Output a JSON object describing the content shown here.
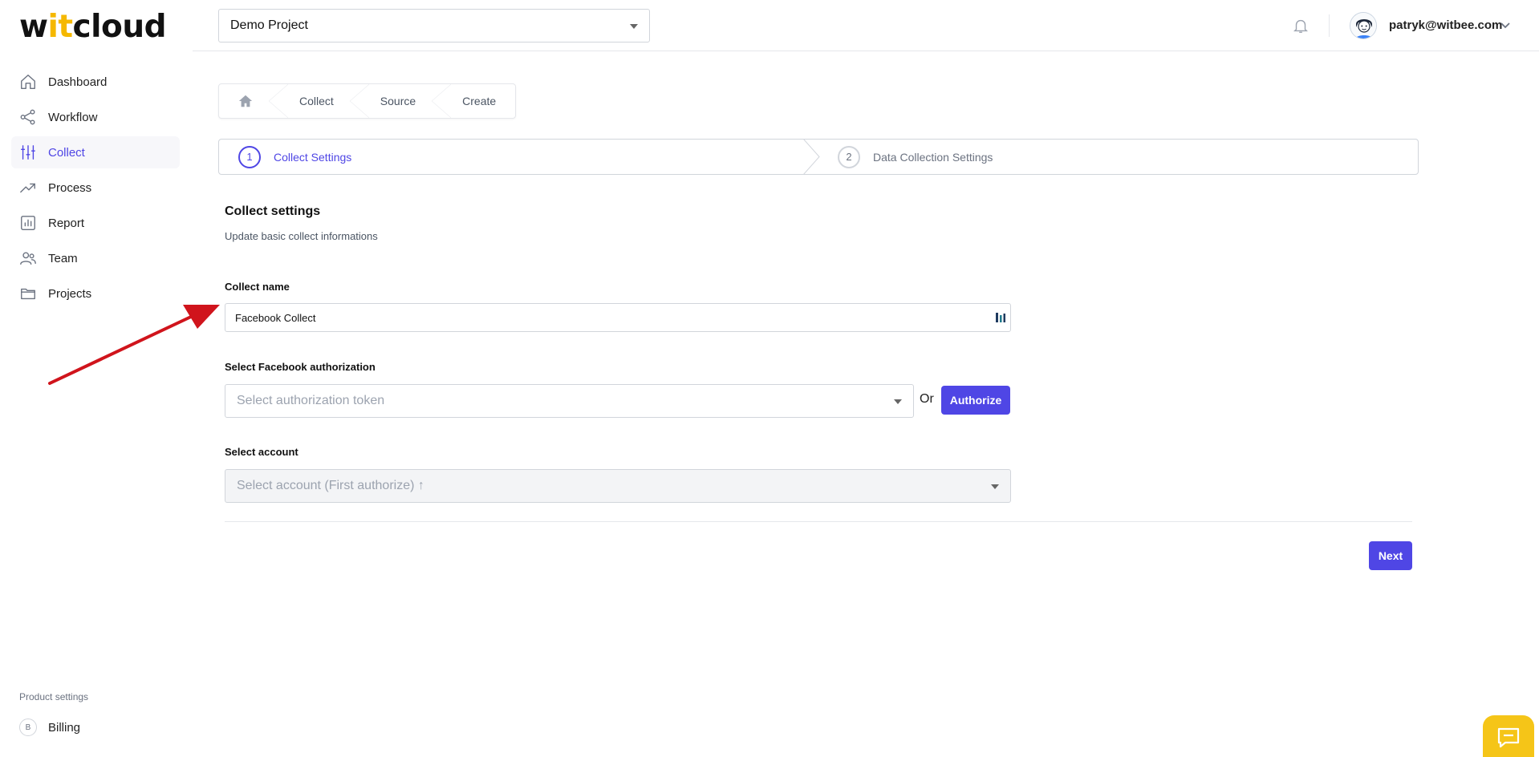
{
  "brand": {
    "name_start": "w",
    "name_accent": "it",
    "name_end": "cloud",
    "accent_color": "#f5b800"
  },
  "sidebar": {
    "items": [
      {
        "label": "Dashboard",
        "icon": "home-icon",
        "active": false
      },
      {
        "label": "Workflow",
        "icon": "share-icon",
        "active": false
      },
      {
        "label": "Collect",
        "icon": "sliders-icon",
        "active": true
      },
      {
        "label": "Process",
        "icon": "trend-icon",
        "active": false
      },
      {
        "label": "Report",
        "icon": "bar-chart-icon",
        "active": false
      },
      {
        "label": "Team",
        "icon": "users-icon",
        "active": false
      },
      {
        "label": "Projects",
        "icon": "folder-icon",
        "active": false
      }
    ],
    "section_label": "Product settings",
    "billing": {
      "badge": "B",
      "label": "Billing"
    }
  },
  "topbar": {
    "project_name": "Demo Project",
    "user_email": "patryk@witbee.com"
  },
  "breadcrumb": [
    "Collect",
    "Source",
    "Create"
  ],
  "stepper": [
    {
      "number": "1",
      "label": "Collect Settings",
      "active": true
    },
    {
      "number": "2",
      "label": "Data Collection Settings",
      "active": false
    }
  ],
  "form": {
    "title": "Collect settings",
    "subtitle": "Update basic collect informations",
    "collect_name_label": "Collect name",
    "collect_name_value": "Facebook Collect",
    "auth_label": "Select Facebook authorization",
    "auth_placeholder": "Select authorization token",
    "or_text": "Or",
    "authorize_label": "Authorize",
    "account_label": "Select account",
    "account_placeholder": "Select account (First authorize) ↑",
    "next_label": "Next"
  },
  "colors": {
    "primary": "#4f46e5",
    "annotation_arrow": "#d0141c",
    "chat_widget": "#f5c518"
  }
}
